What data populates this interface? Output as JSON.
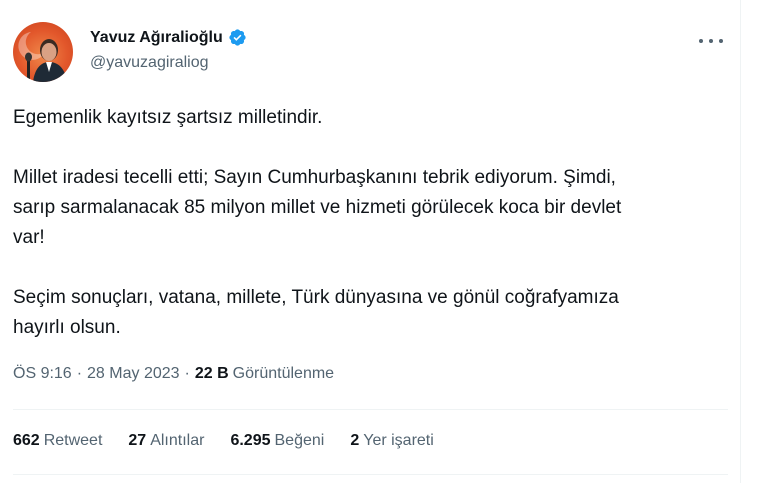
{
  "author": {
    "display_name": "Yavuz Ağıralioğlu",
    "handle": "@yavuzagiraliog",
    "verified": true,
    "avatar_icon": "profile-photo"
  },
  "tweet": {
    "paragraphs": [
      "Egemenlik kayıtsız şartsız milletindir.",
      "Millet iradesi tecelli etti; Sayın Cumhurbaşkanını tebrik ediyorum. Şimdi,\nsarıp sarmalanacak 85 milyon millet ve hizmeti görülecek koca bir devlet\nvar!",
      "Seçim sonuçları, vatana, millete, Türk dünyasına ve gönül coğrafyamıza\nhayırlı olsun."
    ]
  },
  "meta": {
    "time": "ÖS 9:16",
    "separator": "·",
    "date": "28 May 2023",
    "views_count": "22 B",
    "views_label": "Görüntülenme"
  },
  "stats": [
    {
      "count": "662",
      "label": "Retweet"
    },
    {
      "count": "27",
      "label": "Alıntılar"
    },
    {
      "count": "6.295",
      "label": "Beğeni"
    },
    {
      "count": "2",
      "label": "Yer işareti"
    }
  ],
  "colors": {
    "text_primary": "#0f1419",
    "text_secondary": "#536471",
    "verified_blue": "#1d9bf0",
    "divider": "#eff3f4",
    "avatar_bg": "#e2572b"
  },
  "icons": {
    "verified": "verified-badge-icon",
    "more": "more-horizontal-icon"
  }
}
